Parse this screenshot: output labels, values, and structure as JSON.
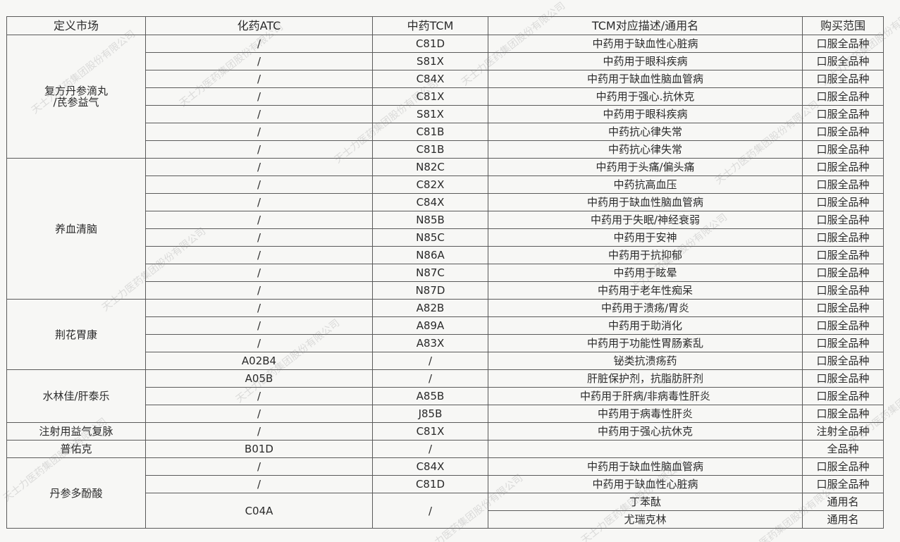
{
  "headers": [
    "定义市场",
    "化药ATC",
    "中药TCM",
    "TCM对应描述/通用名",
    "购买范围"
  ],
  "groups": [
    {
      "market": "复方丹参滴丸\n/芪参益气",
      "rows": [
        [
          "/",
          "C81D",
          "中药用于缺血性心脏病",
          "口服全品种"
        ],
        [
          "/",
          "S81X",
          "中药用于眼科疾病",
          "口服全品种"
        ],
        [
          "/",
          "C84X",
          "中药用于缺血性脑血管病",
          "口服全品种"
        ],
        [
          "/",
          "C81X",
          "中药用于强心.抗休克",
          "口服全品种"
        ],
        [
          "/",
          "S81X",
          "中药用于眼科疾病",
          "口服全品种"
        ],
        [
          "/",
          "C81B",
          "中药抗心律失常",
          "口服全品种"
        ],
        [
          "/",
          "C81B",
          "中药抗心律失常",
          "口服全品种"
        ]
      ]
    },
    {
      "market": "养血清脑",
      "rows": [
        [
          "/",
          "N82C",
          "中药用于头痛/偏头痛",
          "口服全品种"
        ],
        [
          "/",
          "C82X",
          "中药抗高血压",
          "口服全品种"
        ],
        [
          "/",
          "C84X",
          "中药用于缺血性脑血管病",
          "口服全品种"
        ],
        [
          "/",
          "N85B",
          "中药用于失眠/神经衰弱",
          "口服全品种"
        ],
        [
          "/",
          "N85C",
          "中药用于安神",
          "口服全品种"
        ],
        [
          "/",
          "N86A",
          "中药用于抗抑郁",
          "口服全品种"
        ],
        [
          "/",
          "N87C",
          "中药用于眩晕",
          "口服全品种"
        ],
        [
          "/",
          "N87D",
          "中药用于老年性痴呆",
          "口服全品种"
        ]
      ]
    },
    {
      "market": "荆花胃康",
      "rows": [
        [
          "/",
          "A82B",
          "中药用于溃疡/胃炎",
          "口服全品种"
        ],
        [
          "/",
          "A89A",
          "中药用于助消化",
          "口服全品种"
        ],
        [
          "/",
          "A83X",
          "中药用于功能性胃肠紊乱",
          "口服全品种"
        ],
        [
          "A02B4",
          "/",
          "铋类抗溃疡药",
          "口服全品种"
        ]
      ]
    },
    {
      "market": "水林佳/肝泰乐",
      "rows": [
        [
          "A05B",
          "/",
          "肝脏保护剂，抗脂肪肝剂",
          "口服全品种"
        ],
        [
          "/",
          "A85B",
          "中药用于肝病/非病毒性肝炎",
          "口服全品种"
        ],
        [
          "/",
          "J85B",
          "中药用于病毒性肝炎",
          "口服全品种"
        ]
      ]
    },
    {
      "market": "注射用益气复脉",
      "rows": [
        [
          "/",
          "C81X",
          "中药用于强心抗休克",
          "注射全品种"
        ]
      ]
    },
    {
      "market": "普佑克",
      "rows": [
        [
          "B01D",
          "/",
          "",
          "全品种"
        ]
      ]
    },
    {
      "market": "丹参多酚酸",
      "rows": [
        [
          "/",
          "C84X",
          "中药用于缺血性脑血管病",
          "口服全品种"
        ],
        [
          "/",
          "C81D",
          "中药用于缺血性心脏病",
          "口服全品种"
        ],
        [
          "C04A",
          "/",
          "丁苯酞",
          "通用名"
        ],
        [
          null,
          null,
          "尤瑞克林",
          "通用名"
        ]
      ]
    }
  ],
  "watermark": "天士力医药集团股份有限公司"
}
